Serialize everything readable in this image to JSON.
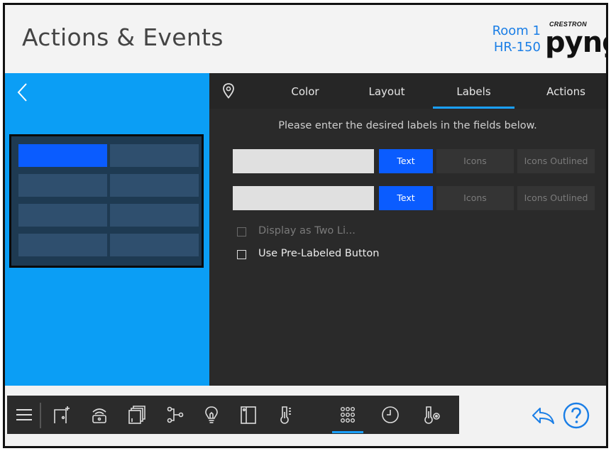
{
  "header": {
    "title": "Actions & Events",
    "room_name": "Room 1",
    "room_model": "HR-150",
    "brand_small": "CRESTRON",
    "brand_big": "pyng"
  },
  "tabs": [
    {
      "label": "Color",
      "active": false
    },
    {
      "label": "Layout",
      "active": false
    },
    {
      "label": "Labels",
      "active": true
    },
    {
      "label": "Actions",
      "active": false
    }
  ],
  "labels_panel": {
    "instruction": "Please enter the desired labels in the fields below.",
    "rows": [
      {
        "value": "",
        "placeholder": "",
        "options": [
          "Text",
          "Icons",
          "Icons Outlined"
        ],
        "selected": "Text"
      },
      {
        "value": "",
        "placeholder": "",
        "options": [
          "Text",
          "Icons",
          "Icons Outlined"
        ],
        "selected": "Text"
      }
    ],
    "checkboxes": [
      {
        "label": "Display as Two Li...",
        "checked": false,
        "enabled": false
      },
      {
        "label": "Use Pre-Labeled Button",
        "checked": false,
        "enabled": true
      }
    ]
  },
  "keypad_preview": {
    "rows": 4,
    "columns": 2,
    "selected_index": 0
  },
  "bottom_nav": {
    "items": [
      "menu-icon",
      "room-add-icon",
      "remote-icon",
      "shades-icon",
      "scene-link-icon",
      "light-bulb-icon",
      "door-sensor-icon",
      "thermometer-icon",
      "keypad-icon",
      "clock-icon",
      "thermostat-icon"
    ],
    "active": "keypad-icon"
  },
  "colors": {
    "accent": "#1aa0ff",
    "selected_button": "#0a5cff",
    "left_panel": "#0b9ef5",
    "right_panel": "#2a2a2a",
    "room_text": "#1a7ee6"
  }
}
